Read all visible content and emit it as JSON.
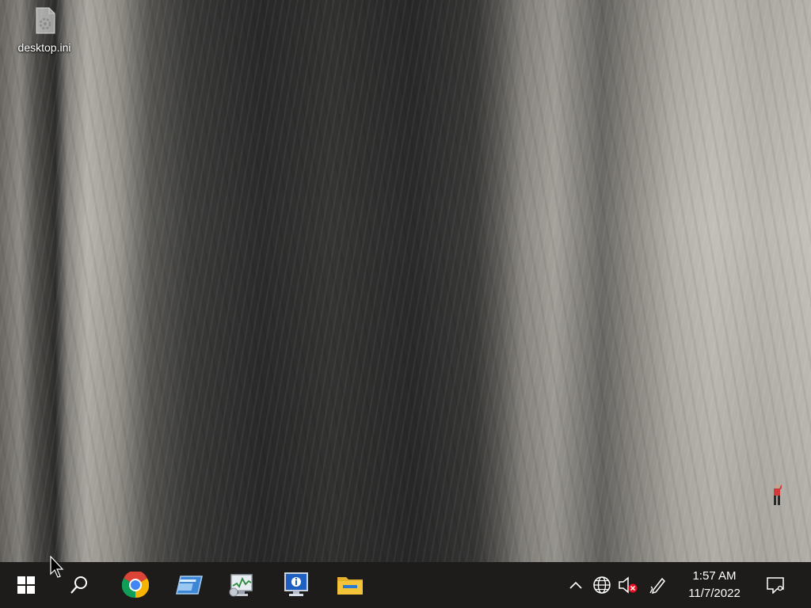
{
  "desktop": {
    "icons": [
      {
        "label": "desktop.ini",
        "icon": "settings-file-icon"
      }
    ]
  },
  "taskbar": {
    "start_icon": "windows-logo-icon",
    "search_icon": "search-icon",
    "pinned": [
      {
        "app": "Google Chrome",
        "icon": "chrome-icon"
      },
      {
        "app": "window-app",
        "icon": "window-app-icon"
      },
      {
        "app": "performance-monitor",
        "icon": "performance-monitor-icon"
      },
      {
        "app": "system-information",
        "icon": "system-info-icon"
      },
      {
        "app": "File Explorer",
        "icon": "folder-icon"
      }
    ],
    "tray": {
      "icons": [
        "chevron-up-icon",
        "globe-network-icon",
        "speaker-muted-icon",
        "pen-icon"
      ],
      "time": "1:57 AM",
      "date": "11/7/2022",
      "notification_icon": "notification-icon"
    }
  },
  "colors": {
    "taskbar": "#1d1c1b",
    "muted_badge": "#e81123",
    "chrome_red": "#db4437",
    "chrome_yellow": "#f4b400",
    "chrome_green": "#0f9d58",
    "chrome_blue": "#4285f4",
    "folder": "#f3c33a"
  }
}
